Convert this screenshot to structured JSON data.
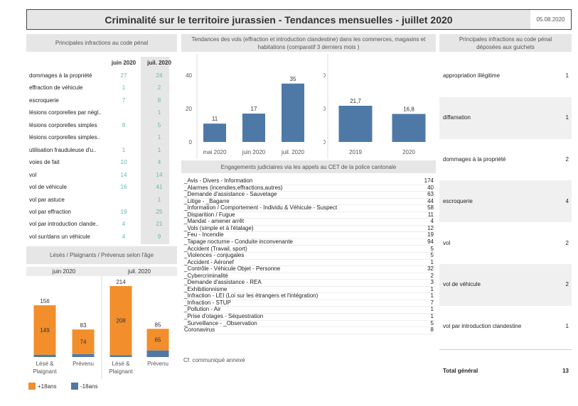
{
  "title": "Criminalité sur le territoire jurassien - Tendances mensuelles - juillet 2020",
  "date": "05.08.2020",
  "infractions": {
    "header": "Principales infractions au code pénal",
    "col1": "juin 2020",
    "col2": "juil. 2020",
    "rows": [
      {
        "label": "dommages à la propriété",
        "v1": "27",
        "v2": "24"
      },
      {
        "label": "effraction de véhicule",
        "v1": "1",
        "v2": "2"
      },
      {
        "label": "escroquerie",
        "v1": "7",
        "v2": "8"
      },
      {
        "label": "lésions corporelles par négl..",
        "v1": "",
        "v2": "1"
      },
      {
        "label": "lésions corporelles simples",
        "v1": "8",
        "v2": "5"
      },
      {
        "label": "lésions corporelles simples..",
        "v1": "",
        "v2": "1"
      },
      {
        "label": "utilisation frauduleuse d'u..",
        "v1": "1",
        "v2": "1"
      },
      {
        "label": "voies de fait",
        "v1": "10",
        "v2": "4"
      },
      {
        "label": "vol",
        "v1": "14",
        "v2": "14"
      },
      {
        "label": "vol de véhicule",
        "v1": "16",
        "v2": "41"
      },
      {
        "label": "vol par astuce",
        "v1": "",
        "v2": "1"
      },
      {
        "label": "vol par effraction",
        "v1": "19",
        "v2": "25"
      },
      {
        "label": "vol par introduction clande..",
        "v1": "4",
        "v2": "21"
      },
      {
        "label": "vol sur/dans un véhicule",
        "v1": "4",
        "v2": "9"
      }
    ]
  },
  "leses": {
    "header": "Lésés / Plaignants / Prévenus selon l'âge",
    "legend_over": "+18ans",
    "legend_under": "-18ans",
    "color_over": "#f28e2b",
    "color_under": "#4e79a7"
  },
  "vols": {
    "header": "Tendances des vols (effraction et introduction clandestine) dans les commerces, magasins et habitations (comparatif 3 derniers mois )"
  },
  "engagements": {
    "header": "Engagements judiciaires via les appels au CET de la police cantonale",
    "footnote": "Cf. communiqué annexé",
    "rows": [
      {
        "label": "_Avis - Divers - Information",
        "value": "174"
      },
      {
        "label": "_Alarmes (incendies,effractions,autres)",
        "value": "40"
      },
      {
        "label": "_Demande d'assistance - Sauvetage",
        "value": "63"
      },
      {
        "label": "_Litige - _Bagarre",
        "value": "44"
      },
      {
        "label": "_Information / Comportement - Individu & Véhicule - Suspect",
        "value": "58"
      },
      {
        "label": "_Disparition / Fugue",
        "value": "11"
      },
      {
        "label": "_Mandat - amener arrêt",
        "value": "4"
      },
      {
        "label": "_Vols (simple et à l'étalage)",
        "value": "12"
      },
      {
        "label": "_Feu - Incendie",
        "value": "19"
      },
      {
        "label": "_Tapage nocturne - Conduite inconvenante",
        "value": "94"
      },
      {
        "label": "_Accident (Travail, sport)",
        "value": "5"
      },
      {
        "label": "_Violences - conjugales",
        "value": "5"
      },
      {
        "label": "_Accident - Aéronef",
        "value": "1"
      },
      {
        "label": "_Contrôle - Véhicule Objet - Personne",
        "value": "32"
      },
      {
        "label": "_Cybercriminalité",
        "value": "2"
      },
      {
        "label": "_Demande d'assistance - REA",
        "value": "3"
      },
      {
        "label": "_Exhibitionnisme",
        "value": "1"
      },
      {
        "label": "_Infraction - LEI (Loi sur les étrangers et l'intégration)",
        "value": "1"
      },
      {
        "label": "_Infraction - STUP",
        "value": "7"
      },
      {
        "label": "_Pollution - Air",
        "value": "1"
      },
      {
        "label": "_Prise d'otages - Séquestration",
        "value": "1"
      },
      {
        "label": "_Surveillance - _Observation",
        "value": "5"
      },
      {
        "label": "Coronavirus",
        "value": "8"
      }
    ]
  },
  "guichets": {
    "header": "Principales infractions au code pénal déposées aux guichets",
    "rows": [
      {
        "label": "appropriation illégitime",
        "value": "1"
      },
      {
        "label": "diffamation",
        "value": "1"
      },
      {
        "label": "dommages à la propriété",
        "value": "2"
      },
      {
        "label": "escroquerie",
        "value": "4"
      },
      {
        "label": "vol",
        "value": "2"
      },
      {
        "label": "vol de véhicule",
        "value": "2"
      },
      {
        "label": "vol par introduction clandestine",
        "value": "1"
      }
    ],
    "total_label": "Total général",
    "total_value": "13"
  },
  "chart_data": [
    {
      "type": "bar",
      "categories": [
        "mai 2020",
        "juin 2020",
        "juil. 2020"
      ],
      "values": [
        11,
        17,
        35
      ],
      "ylim": [
        0,
        40
      ],
      "yticks": [
        "0",
        "20",
        "40"
      ],
      "value_labels": [
        "11",
        "17",
        "35"
      ]
    },
    {
      "type": "bar",
      "categories": [
        "2019",
        "2020"
      ],
      "values": [
        21.7,
        16.8
      ],
      "ylim": [
        0,
        40
      ],
      "yticks": [
        "0",
        "20",
        "40"
      ],
      "value_labels": [
        "21,7",
        "16,8"
      ]
    },
    {
      "type": "bar",
      "stacked": true,
      "panels": [
        "juin 2020",
        "juil. 2020"
      ],
      "categories": [
        "Lésé & Plaignant",
        "Prévenu"
      ],
      "series": [
        {
          "name": "+18ans",
          "values": [
            [
              149,
              74
            ],
            [
              208,
              65
            ]
          ]
        },
        {
          "name": "-18ans",
          "values": [
            [
              7,
              9
            ],
            [
              6,
              20
            ]
          ]
        }
      ],
      "totals": [
        [
          156,
          83
        ],
        [
          214,
          85
        ]
      ],
      "ymax": 214
    }
  ]
}
